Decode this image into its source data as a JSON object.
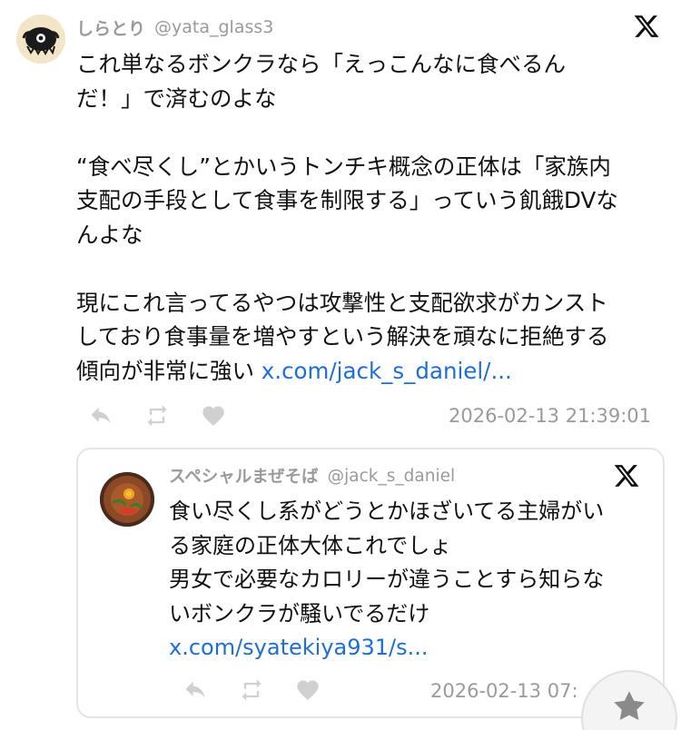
{
  "tweet": {
    "author_name": "しらとり",
    "author_handle": "@yata_glass3",
    "lines": [
      "これ単なるボンクラなら「えっこんなに食べるん",
      "だ！」で済むのよな",
      "",
      "“食べ尽くし”とかいうトンチキ概念の正体は「家族内",
      "支配の手段として食事を制限する」っていう飢餓DVな",
      "んよな",
      "",
      "現にこれ言ってるやつは攻撃性と支配欲求がカンスト",
      "しており食事量を増やすという解決を頑なに拒絶する"
    ],
    "last_line_text": "傾向が非常に強い",
    "link": "x.com/jack_s_daniel/...",
    "timestamp": "2026-02-13 21:39:01"
  },
  "quote": {
    "author_name": "スペシャルまぜそば",
    "author_handle": "@jack_s_daniel",
    "lines": [
      "食い尽くし系がどうとかほざいてる主婦がい",
      "る家庭の正体大体これでしょ",
      "男女で必要なカロリーが違うことすら知らな",
      "いボンクラが騒いでるだけ"
    ],
    "link": "x.com/syatekiya931/s...",
    "timestamp": "2026-02-13 07:"
  },
  "icons": {
    "brand": "x-logo-icon",
    "reply": "reply-icon",
    "retweet": "retweet-icon",
    "like": "heart-icon",
    "fab": "star-icon"
  },
  "colors": {
    "link": "#1d6fd6",
    "muted": "#9a9a9a",
    "action_icon": "#d0d0d0"
  }
}
